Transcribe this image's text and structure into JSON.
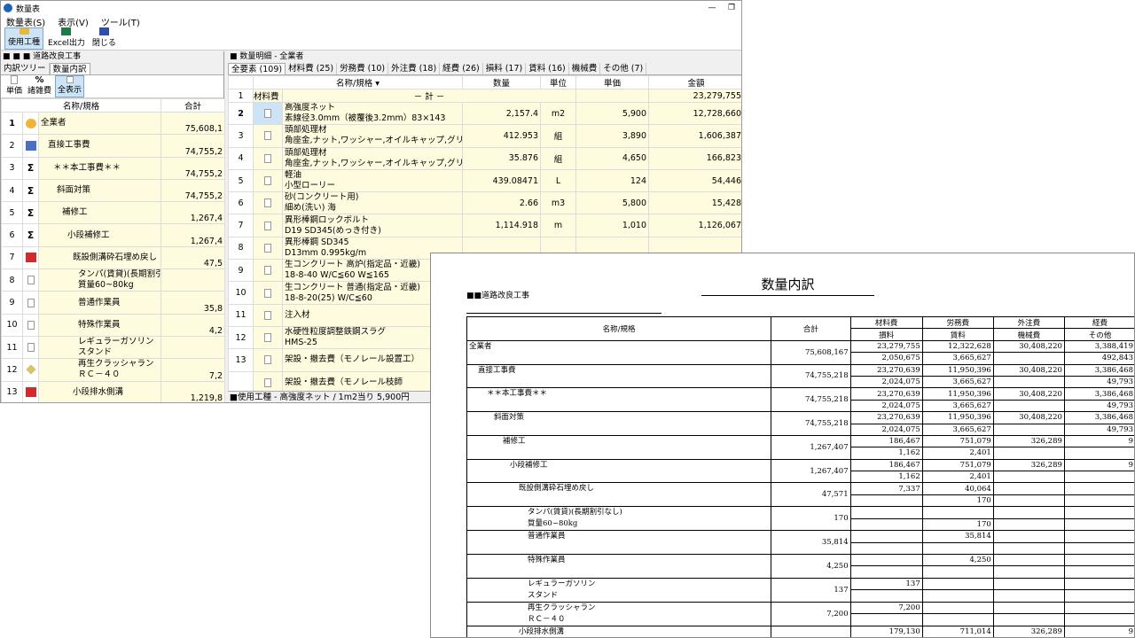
{
  "window": {
    "title": "数量表",
    "controls": [
      "—",
      "❐"
    ]
  },
  "menu": [
    "数量表(S)",
    "表示(V)",
    "ツール(T)"
  ],
  "toolbar": [
    {
      "label": "使用工種",
      "icon": "folder-icon"
    },
    {
      "label": "Excel出力",
      "icon": "excel-icon"
    },
    {
      "label": "閉じる",
      "icon": "close-icon"
    }
  ],
  "left": {
    "header": "■ ■ ■ 道路改良工事",
    "tabs": [
      "内訳ツリー",
      "数量内訳"
    ],
    "subtools": [
      {
        "top": "",
        "label": "単価"
      },
      {
        "top": "%",
        "label": "諸雑費"
      },
      {
        "top": "",
        "label": "全表示"
      }
    ],
    "columns": [
      "名称/規格",
      "合計"
    ],
    "rows": [
      {
        "no": "1",
        "icon": "star",
        "name": "全業者",
        "total": "75,608,1"
      },
      {
        "no": "2",
        "icon": "blue",
        "name": "直接工事費",
        "total": "74,755,2"
      },
      {
        "no": "3",
        "icon": "sigma",
        "name": "＊＊本工事費＊＊",
        "total": "74,755,2"
      },
      {
        "no": "4",
        "icon": "sigma",
        "name": "斜面対策",
        "total": "74,755,2"
      },
      {
        "no": "5",
        "icon": "sigma",
        "name": "補修工",
        "total": "1,267,4"
      },
      {
        "no": "6",
        "icon": "sigma",
        "name": "小段補修工",
        "total": "1,267,4"
      },
      {
        "no": "7",
        "icon": "red",
        "name": "既設側溝砕石埋め戻し",
        "total": "47,5"
      },
      {
        "no": "8",
        "icon": "doc",
        "name": "タンパ(賃貸)(長期割引",
        "name2": "質量60~80kg",
        "total": ""
      },
      {
        "no": "9",
        "icon": "doc",
        "name": "普通作業員",
        "total": "35,8"
      },
      {
        "no": "10",
        "icon": "doc",
        "name": "特殊作業員",
        "total": "4,2"
      },
      {
        "no": "11",
        "icon": "doc",
        "name": "レギュラーガソリン",
        "name2": "スタンド",
        "total": ""
      },
      {
        "no": "12",
        "icon": "pen",
        "name": "再生クラッシャラン",
        "name2": "ＲＣ－４０",
        "total": "7,2"
      },
      {
        "no": "13",
        "icon": "red",
        "name": "小段排水側溝",
        "total": "1,219,8"
      }
    ]
  },
  "right": {
    "header": "■ 数量明細 - 全業者",
    "tabs": [
      "全要素 (109)",
      "材料費 (25)",
      "労務費 (10)",
      "外注費 (18)",
      "経費 (26)",
      "損料 (17)",
      "賃料 (16)",
      "機械費",
      "その他 (7)"
    ],
    "columns": [
      "名称/規格",
      "数量",
      "単位",
      "単価",
      "金額"
    ],
    "total_row": {
      "no": "1",
      "label": "材料費",
      "name": "－ 計 －",
      "amount": "23,279,755"
    },
    "rows": [
      {
        "no": "2",
        "name": "高強度ネット",
        "spec": "素線径3.0mm（被覆後3.2mm）83×143",
        "qty": "2,157.4",
        "unit": "m2",
        "price": "5,900",
        "amount": "12,728,660"
      },
      {
        "no": "3",
        "name": "頭部処理材",
        "spec": "角座金,ナット,ワッシャー,オイルキャップ,グリス等",
        "qty": "412.953",
        "unit": "組",
        "price": "3,890",
        "amount": "1,606,387"
      },
      {
        "no": "4",
        "name": "頭部処理材",
        "spec": "角座金,ナット,ワッシャー,オイルキャップ,グリス等",
        "qty": "35.876",
        "unit": "組",
        "price": "4,650",
        "amount": "166,823"
      },
      {
        "no": "5",
        "name": "軽油",
        "spec": "小型ローリー",
        "qty": "439.08471",
        "unit": "L",
        "price": "124",
        "amount": "54,446"
      },
      {
        "no": "6",
        "name": "砂(コンクリート用)",
        "spec": "細め(洗い) 海",
        "qty": "2.66",
        "unit": "m3",
        "price": "5,800",
        "amount": "15,428"
      },
      {
        "no": "7",
        "name": "異形棒鋼ロックボルト",
        "spec": "D19 SD345(めっき付き)",
        "qty": "1,114.918",
        "unit": "m",
        "price": "1,010",
        "amount": "1,126,067"
      },
      {
        "no": "8",
        "name": "異形棒鋼 SD345",
        "spec": "D13mm 0.995kg/m",
        "qty": "",
        "unit": "",
        "price": "",
        "amount": ""
      },
      {
        "no": "9",
        "name": "生コンクリート 高炉(指定品・近畿)",
        "spec": "18-8-40 W/C≦60 W≦165",
        "qty": "",
        "unit": "",
        "price": "",
        "amount": ""
      },
      {
        "no": "10",
        "name": "生コンクリート 普通(指定品・近畿)",
        "spec": "18-8-20(25) W/C≦60",
        "qty": "",
        "unit": "",
        "price": "",
        "amount": ""
      },
      {
        "no": "11",
        "name": "注入材",
        "spec": "",
        "qty": "",
        "unit": "",
        "price": "",
        "amount": ""
      },
      {
        "no": "12",
        "name": "水硬性粒度調整鉄鋼スラグ",
        "spec": "HMS-25",
        "qty": "",
        "unit": "",
        "price": "",
        "amount": ""
      },
      {
        "no": "13",
        "name": "架設・撤去費（モノレール設置工）",
        "spec": "",
        "qty": "",
        "unit": "",
        "price": "",
        "amount": ""
      },
      {
        "no": "",
        "name": "架設・撤去費（モノレール枝師",
        "spec": "",
        "qty": "",
        "unit": "",
        "price": "",
        "amount": ""
      }
    ],
    "status": "■使用工種 - 高強度ネット / 1m2当り 5,900円"
  },
  "report": {
    "title": "数量内訳",
    "subtitle": "■■道路改良工事",
    "headers": {
      "name": "名称/規格",
      "total": "合計",
      "top": [
        "材料費",
        "労務費",
        "外注費",
        "経費"
      ],
      "bottom": [
        "損料",
        "賃料",
        "機械費",
        "その他"
      ]
    },
    "rows": [
      {
        "indent": 0,
        "name": "全業者",
        "name2": "",
        "total": "75,608,167",
        "a": [
          "23,279,755",
          "12,322,628",
          "30,408,220",
          "3,388,419"
        ],
        "b": [
          "2,050,675",
          "3,665,627",
          "",
          "492,843"
        ]
      },
      {
        "indent": 1,
        "name": "直接工事費",
        "name2": "",
        "total": "74,755,218",
        "a": [
          "23,270,639",
          "11,950,396",
          "30,408,220",
          "3,386,468"
        ],
        "b": [
          "2,024,075",
          "3,665,627",
          "",
          "49,793"
        ]
      },
      {
        "indent": 2,
        "name": "＊＊本工事費＊＊",
        "name2": "",
        "total": "74,755,218",
        "a": [
          "23,270,639",
          "11,950,396",
          "30,408,220",
          "3,386,468"
        ],
        "b": [
          "2,024,075",
          "3,665,627",
          "",
          "49,793"
        ]
      },
      {
        "indent": 3,
        "name": "斜面対策",
        "name2": "",
        "total": "74,755,218",
        "a": [
          "23,270,639",
          "11,950,396",
          "30,408,220",
          "3,386,468"
        ],
        "b": [
          "2,024,075",
          "3,665,627",
          "",
          "49,793"
        ]
      },
      {
        "indent": 4,
        "name": "補修工",
        "name2": "",
        "total": "1,267,407",
        "a": [
          "186,467",
          "751,079",
          "326,289",
          "9"
        ],
        "b": [
          "1,162",
          "2,401",
          "",
          ""
        ]
      },
      {
        "indent": 5,
        "name": "小段補修工",
        "name2": "",
        "total": "1,267,407",
        "a": [
          "186,467",
          "751,079",
          "326,289",
          "9"
        ],
        "b": [
          "1,162",
          "2,401",
          "",
          ""
        ]
      },
      {
        "indent": 6,
        "name": "既設側溝砕石埋め戻し",
        "name2": "",
        "total": "47,571",
        "a": [
          "7,337",
          "40,064",
          "",
          ""
        ],
        "b": [
          "",
          "170",
          "",
          ""
        ]
      },
      {
        "indent": 7,
        "name": "タンパ(賃貸)(長期割引なし)",
        "name2": "質量60~80kg",
        "total": "170",
        "a": [
          "",
          "",
          "",
          ""
        ],
        "b": [
          "",
          "170",
          "",
          ""
        ]
      },
      {
        "indent": 7,
        "name": "普通作業員",
        "name2": "",
        "total": "35,814",
        "a": [
          "",
          "35,814",
          "",
          ""
        ],
        "b": [
          "",
          "",
          "",
          ""
        ]
      },
      {
        "indent": 7,
        "name": "特殊作業員",
        "name2": "",
        "total": "4,250",
        "a": [
          "",
          "4,250",
          "",
          ""
        ],
        "b": [
          "",
          "",
          "",
          ""
        ]
      },
      {
        "indent": 7,
        "name": "レギュラーガソリン",
        "name2": "スタンド",
        "total": "137",
        "a": [
          "137",
          "",
          "",
          ""
        ],
        "b": [
          "",
          "",
          "",
          ""
        ]
      },
      {
        "indent": 7,
        "name": "再生クラッシャラン",
        "name2": "ＲＣ－４０",
        "total": "7,200",
        "a": [
          "7,200",
          "",
          "",
          ""
        ],
        "b": [
          "",
          "",
          "",
          ""
        ]
      },
      {
        "indent": 6,
        "name": "小段排水側溝",
        "name2": "",
        "total": "",
        "a": [
          "179,130",
          "711,014",
          "326,289",
          "9"
        ],
        "b": [
          "",
          "",
          "",
          ""
        ]
      }
    ]
  }
}
